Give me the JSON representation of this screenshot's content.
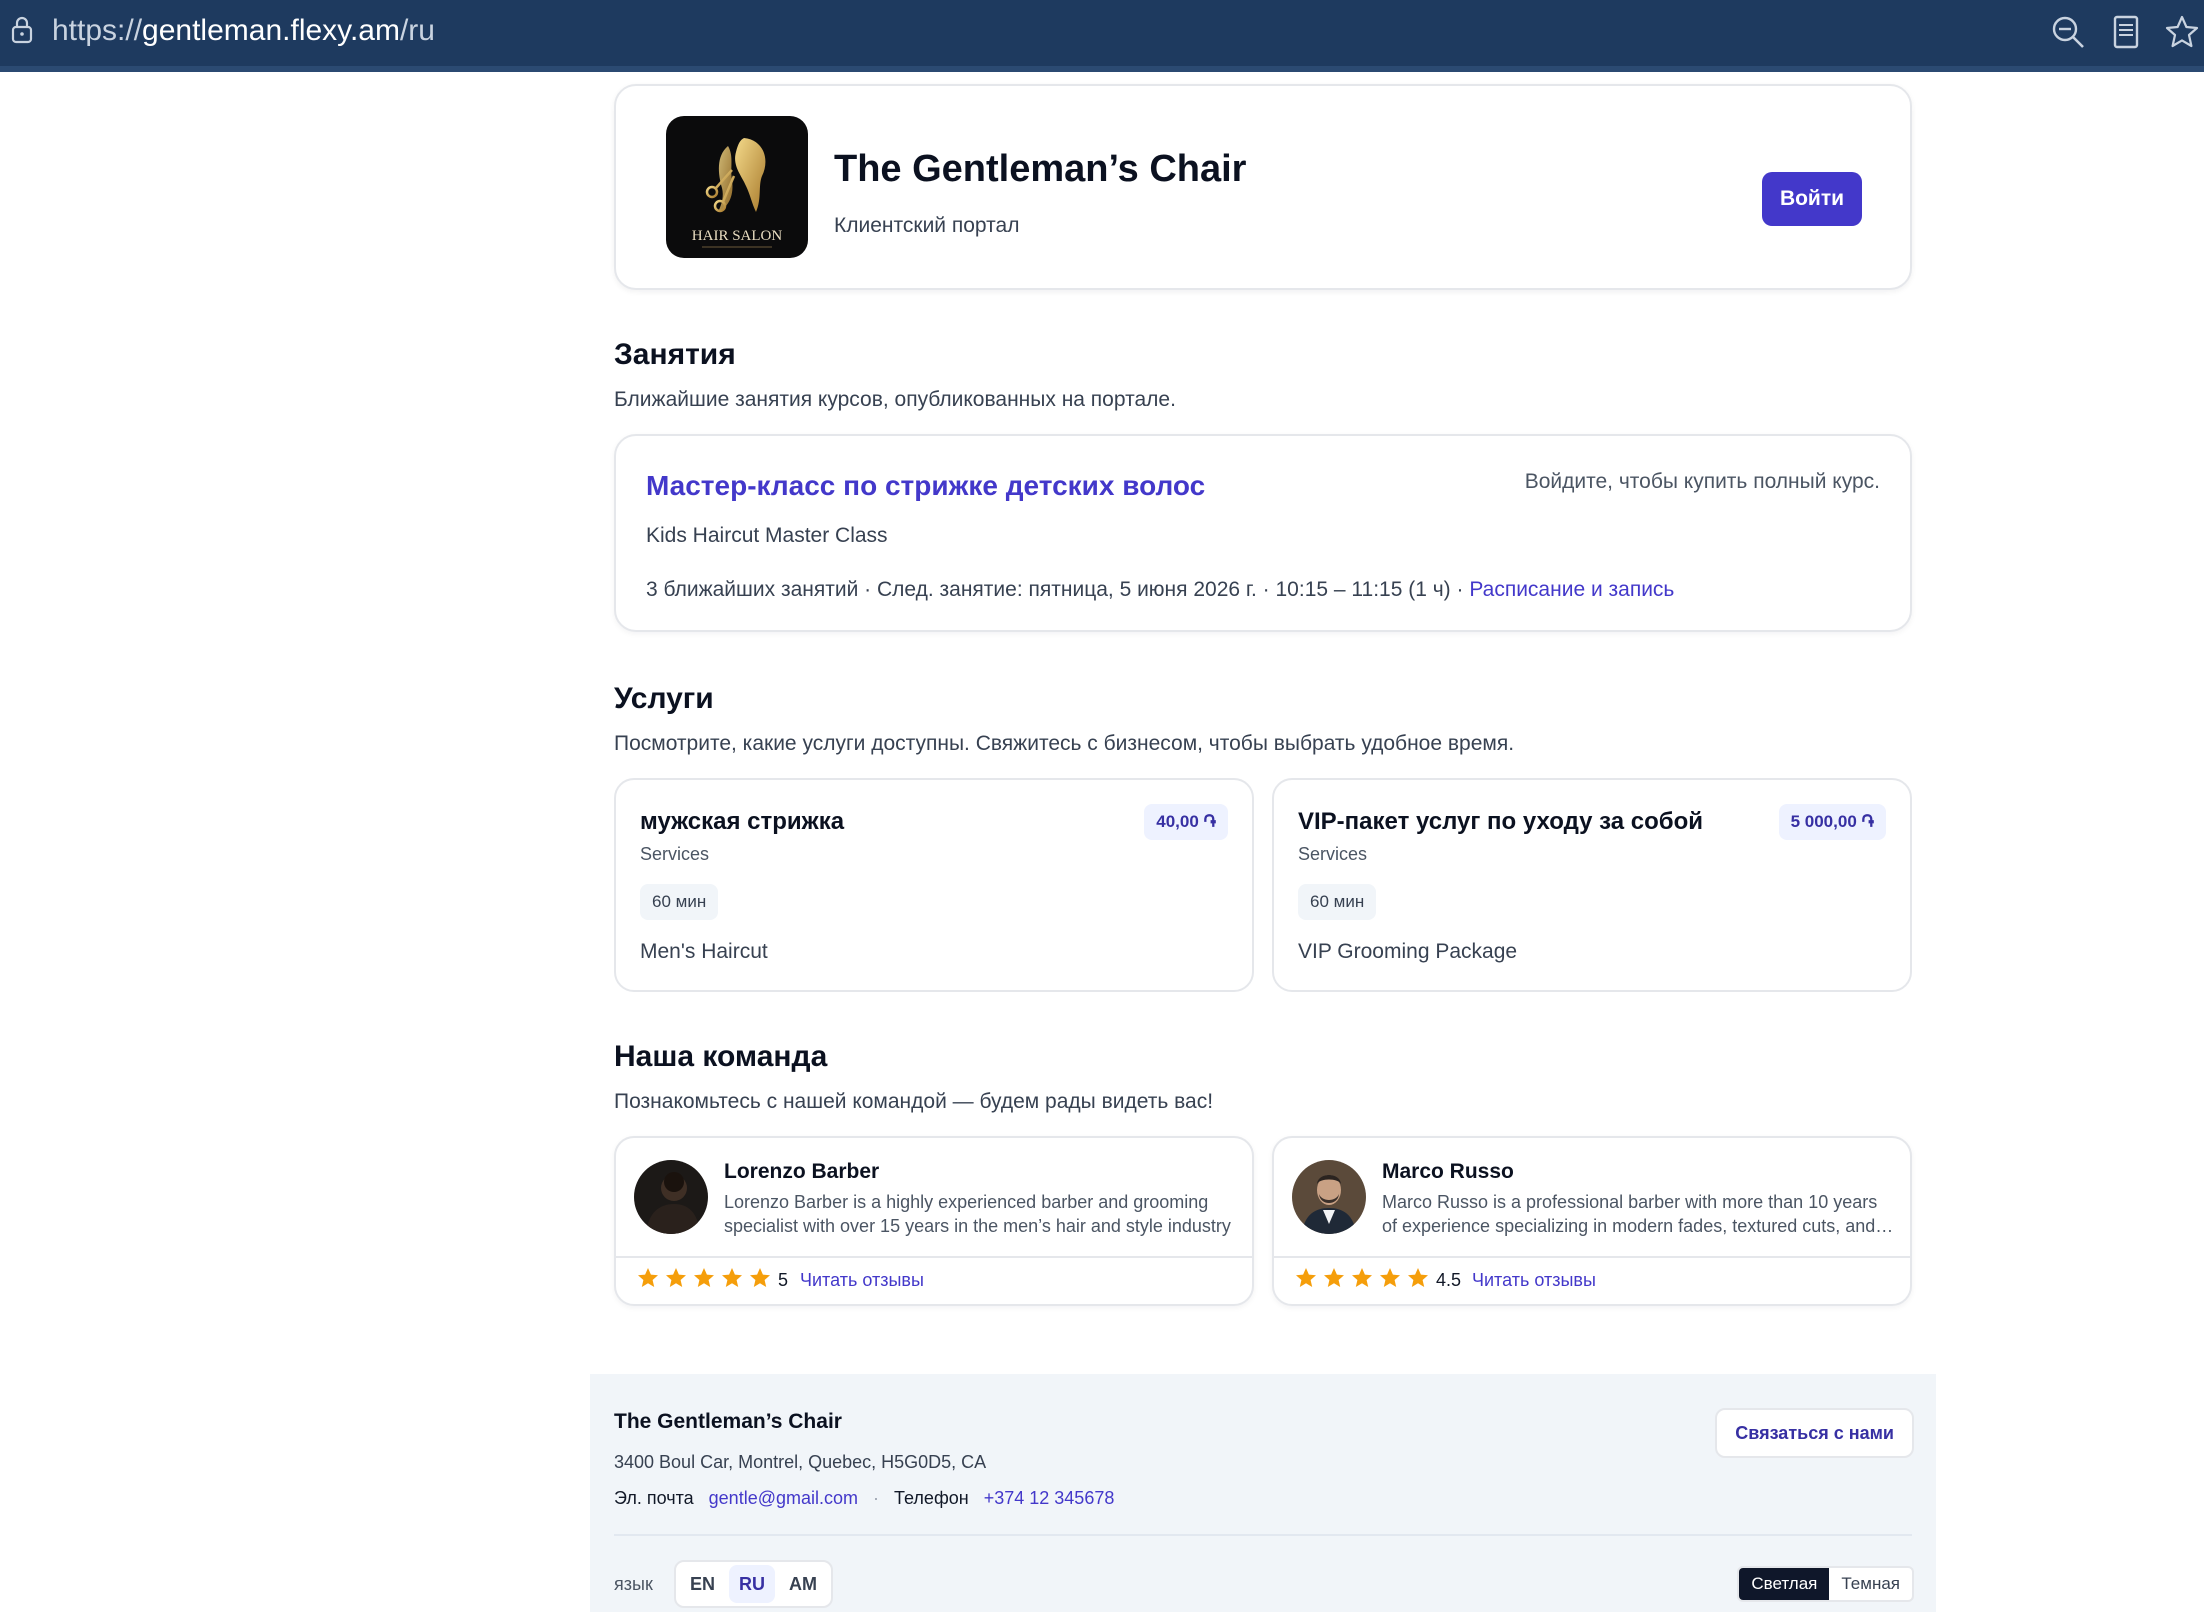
{
  "browser": {
    "url_scheme": "https://",
    "url_host": "gentleman.flexy.am",
    "url_path": "/ru"
  },
  "header": {
    "logo_text": "HAIR SALON",
    "business_name": "The Gentleman’s Chair",
    "subtitle": "Клиентский портал",
    "login_label": "Войти"
  },
  "classes": {
    "title": "Занятия",
    "subtitle": "Ближайшие занятия курсов, опубликованных на портале.",
    "course": {
      "title": "Мастер-класс по стрижке детских волос",
      "note": "Войдите, чтобы купить полный курс.",
      "title_en": "Kids Haircut Master Class",
      "meta": "3 ближайших занятий · След. занятие: пятница, 5 июня 2026 г. · 10:15 – 11:15 (1 ч) · ",
      "schedule_link": "Расписание и запись"
    }
  },
  "services": {
    "title": "Услуги",
    "subtitle": "Посмотрите, какие услуги доступны. Свяжитесь с бизнесом, чтобы выбрать удобное время.",
    "items": [
      {
        "name": "мужская стрижка",
        "category": "Services",
        "price": "40,00 ֏",
        "duration": "60 мин",
        "description": "Men's Haircut"
      },
      {
        "name": "VIP-пакет услуг по уходу за собой",
        "category": "Services",
        "price": "5 000,00 ֏",
        "duration": "60 мин",
        "description": "VIP Grooming Package"
      }
    ]
  },
  "team": {
    "title": "Наша команда",
    "subtitle": "Познакомьтесь с нашей командой — будем рады видеть вас!",
    "members": [
      {
        "name": "Lorenzo Barber",
        "bio_line1": "Lorenzo Barber is a highly experienced barber and grooming",
        "bio_line2": "specialist with over 15 years in the men’s hair and style industry",
        "rating": "5",
        "rating_value": 5,
        "reviews_label": "Читать отзывы"
      },
      {
        "name": "Marco Russo",
        "bio_line1": "Marco Russo is a professional barber with more than 10 years",
        "bio_line2": "of experience specializing in modern fades, textured cuts, and beard",
        "rating": "4.5",
        "rating_value": 4.5,
        "reviews_label": "Читать отзывы"
      }
    ]
  },
  "footer": {
    "business_name": "The Gentleman’s Chair",
    "address": "3400 Boul Car, Montrel, Quebec, H5G0D5, CA",
    "email_label": "Эл. почта",
    "email": "gentle@gmail.com",
    "phone_label": "Телефон",
    "phone": "+374 12 345678",
    "contact_button": "Связаться с нами",
    "language_label": "язык",
    "languages": [
      "EN",
      "RU",
      "AM"
    ],
    "active_language": "RU",
    "theme_light": "Светлая",
    "theme_dark": "Темная",
    "active_theme": "light"
  },
  "colors": {
    "accent": "#4338ca",
    "star": "#f59e0b",
    "chrome": "#1e3a5f"
  }
}
